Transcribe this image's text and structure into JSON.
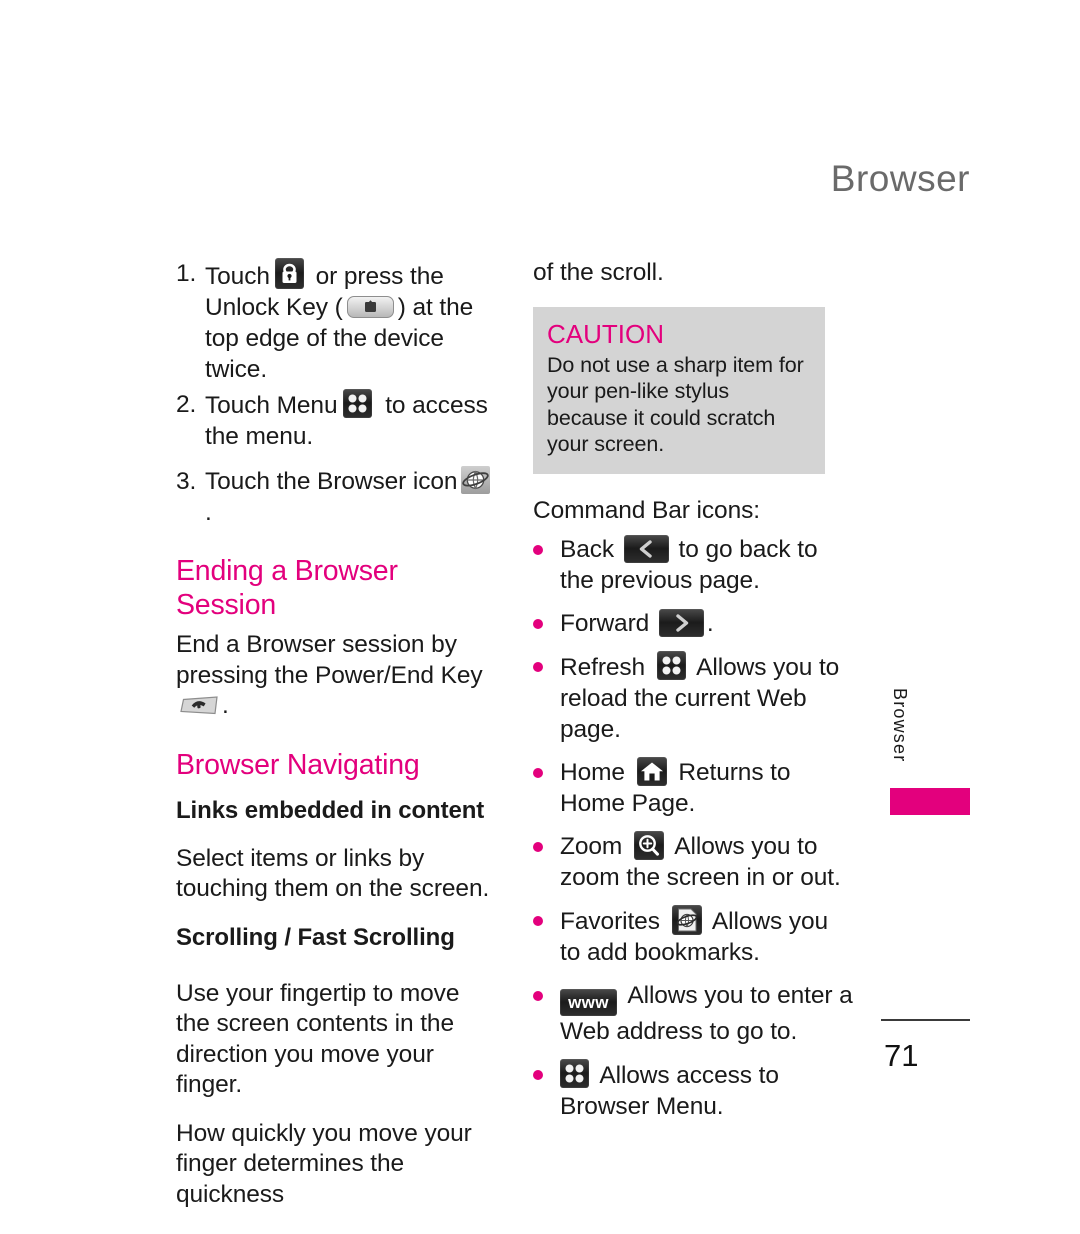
{
  "document": {
    "chapter_header": "Browser",
    "page_number": "71",
    "side_tab_label": "Browser",
    "accent_color": "#e3007d",
    "header_color": "#6a6a6a",
    "caution_bg": "#d4d4d4"
  },
  "left_column": {
    "steps": [
      {
        "marker": "1.",
        "text_before_icon": "Touch",
        "icon": "lock-icon",
        "text_after_icon": " or press the Unlock Key (",
        "icon2": "unlock-key-icon",
        "text_end": ") at the top edge of the device twice."
      },
      {
        "marker": "2.",
        "text_before_icon": "Touch Menu",
        "icon": "four-dots-menu-icon",
        "text_after_icon": " to access the menu."
      },
      {
        "marker": "3.",
        "text_before_icon": "Touch the Browser icon",
        "icon": "globe-browser-icon",
        "text_after_icon": "."
      }
    ],
    "heading_ending_session": "Ending a Browser Session",
    "ending_session_text_before_icon": "End a Browser session by pressing the Power/End Key",
    "ending_session_icon": "power-end-key-icon",
    "ending_session_text_after_icon": ".",
    "heading_browser_navigating": "Browser Navigating",
    "subheading_links": "Links embedded in content",
    "links_text": "Select items or links by touching them on the screen.",
    "subheading_scrolling": "Scrolling / Fast Scrolling",
    "scrolling_text_1": "Use your fingertip to move the screen contents in the direction you move your finger.",
    "scrolling_text_2": "How quickly you move your finger determines the quickness"
  },
  "right_column": {
    "continuation_text": "of the scroll.",
    "caution": {
      "title": "CAUTION",
      "body": "Do not use a sharp item for your pen-like stylus because it could scratch your screen."
    },
    "command_bar_intro": "Command Bar icons:",
    "command_bar_items": [
      {
        "label": "Back",
        "icon": "back-arrow-icon",
        "description": " to go back to the previous page."
      },
      {
        "label": "Forward",
        "icon": "forward-arrow-icon",
        "description": "."
      },
      {
        "label": "Refresh",
        "icon": "refresh-four-dots-icon",
        "description": " Allows you to reload the current Web page."
      },
      {
        "label": "Home",
        "icon": "home-icon",
        "description": " Returns to Home Page."
      },
      {
        "label": "Zoom",
        "icon": "zoom-magnifier-icon",
        "description": " Allows you to zoom the screen in or out."
      },
      {
        "label": "Favorites",
        "icon": "favorites-icon",
        "description": " Allows you to add bookmarks."
      },
      {
        "label": "",
        "icon": "www-icon",
        "icon_text": "www",
        "description": " Allows you to enter a Web address to go to."
      },
      {
        "label": "",
        "icon": "browser-menu-four-dots-icon",
        "description": " Allows access to Browser Menu."
      }
    ]
  }
}
